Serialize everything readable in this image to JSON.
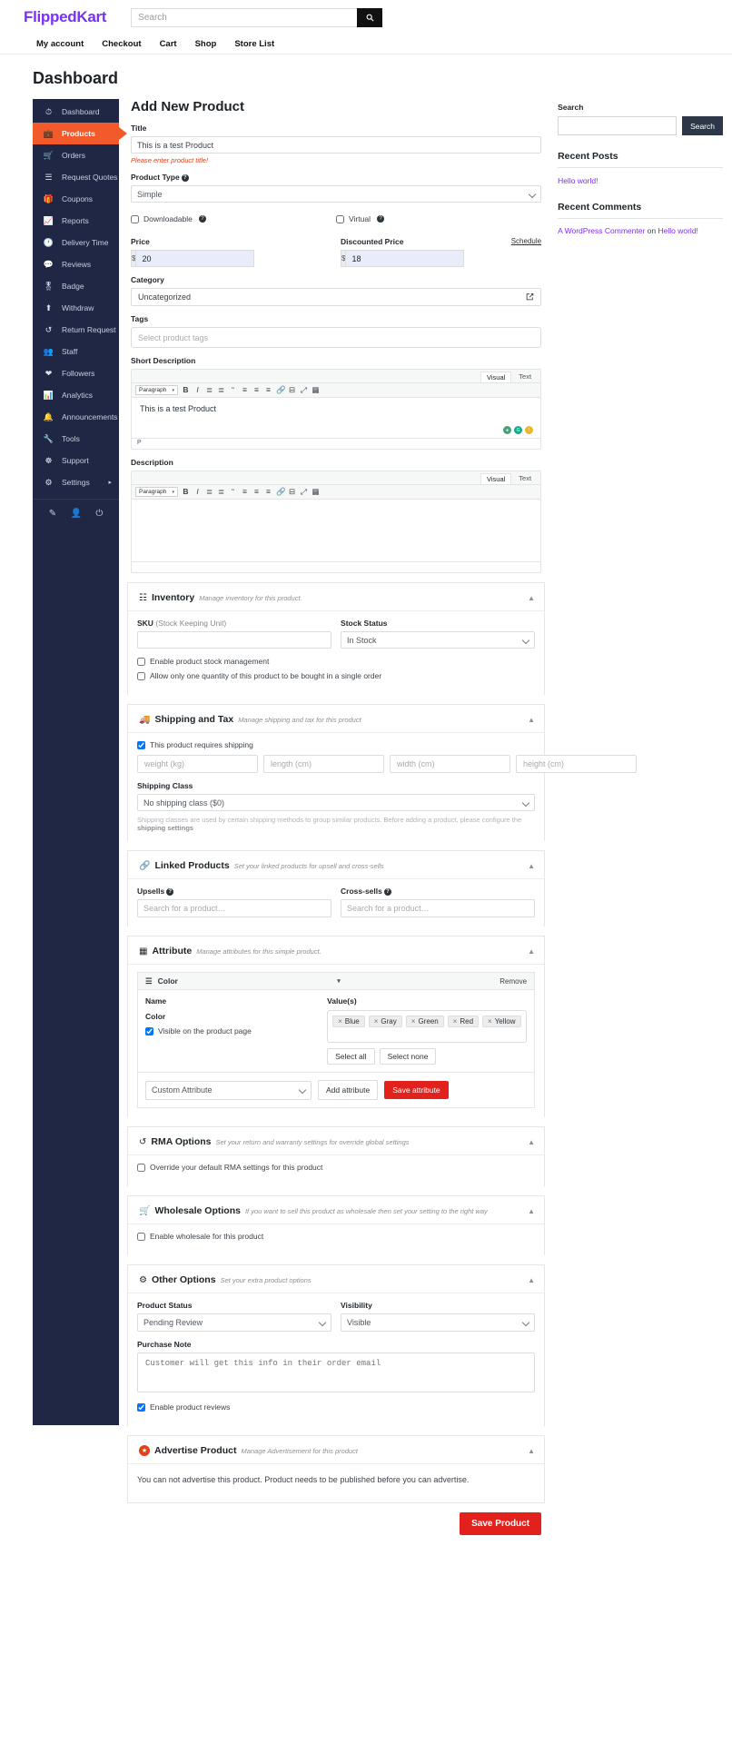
{
  "header": {
    "brand": "FlippedKart",
    "search_placeholder": "Search",
    "search_value": "",
    "search_icon": "search-icon",
    "nav": [
      "My account",
      "Checkout",
      "Cart",
      "Shop",
      "Store List"
    ]
  },
  "page": {
    "title": "Dashboard"
  },
  "sidebar": {
    "items": [
      {
        "label": "Dashboard",
        "icon": "speedometer-icon",
        "active": false
      },
      {
        "label": "Products",
        "icon": "briefcase-icon",
        "active": true
      },
      {
        "label": "Orders",
        "icon": "cart-icon",
        "active": false
      },
      {
        "label": "Request Quotes",
        "icon": "list-icon",
        "active": false
      },
      {
        "label": "Coupons",
        "icon": "gift-icon",
        "active": false
      },
      {
        "label": "Reports",
        "icon": "chart-icon",
        "active": false
      },
      {
        "label": "Delivery Time",
        "icon": "clock-icon",
        "active": false
      },
      {
        "label": "Reviews",
        "icon": "comment-icon",
        "active": false
      },
      {
        "label": "Badge",
        "icon": "medal-icon",
        "active": false
      },
      {
        "label": "Withdraw",
        "icon": "upload-icon",
        "active": false
      },
      {
        "label": "Return Request",
        "icon": "undo-icon",
        "active": false
      },
      {
        "label": "Staff",
        "icon": "users-icon",
        "active": false
      },
      {
        "label": "Followers",
        "icon": "heart-icon",
        "active": false
      },
      {
        "label": "Analytics",
        "icon": "bars-icon",
        "active": false
      },
      {
        "label": "Announcements",
        "icon": "bell-icon",
        "active": false
      },
      {
        "label": "Tools",
        "icon": "wrench-icon",
        "active": false
      },
      {
        "label": "Support",
        "icon": "lifering-icon",
        "active": false
      },
      {
        "label": "Settings",
        "icon": "gear-icon",
        "active": false,
        "caret": "▸"
      }
    ],
    "bottom_icons": [
      "edit-icon",
      "user-icon",
      "power-icon"
    ]
  },
  "main": {
    "title": "Add New Product",
    "title_label": "Title",
    "title_value": "This is a test Product",
    "title_error": "Please enter product title!",
    "product_type_label": "Product Type",
    "product_type_value": "Simple",
    "downloadable_label": "Downloadable",
    "virtual_label": "Virtual",
    "price_label": "Price",
    "price_currency": "$",
    "price_value": "20",
    "discounted_label": "Discounted Price",
    "discounted_currency": "$",
    "discounted_value": "18",
    "schedule_label": "Schedule",
    "category_label": "Category",
    "category_value": "Uncategorized",
    "category_edit_icon": "edit-square-icon",
    "tags_label": "Tags",
    "tags_placeholder": "Select product tags",
    "short_desc_label": "Short Description",
    "short_desc_body": "This is a test Product",
    "short_desc_status": "P",
    "desc_label": "Description",
    "desc_body": "",
    "editor_tabs": [
      "Visual",
      "Text"
    ],
    "editor_paragraph": "Paragraph",
    "editor_buttons": [
      "bold-icon",
      "italic-icon",
      "bulleted-list-icon",
      "numbered-list-icon",
      "blockquote-icon",
      "align-left-icon",
      "align-center-icon",
      "align-right-icon",
      "link-icon",
      "read-more-icon",
      "fullscreen-icon",
      "toolbar-toggle-icon"
    ]
  },
  "inventory": {
    "title": "Inventory",
    "subtitle": "Manage inventory for this product.",
    "icon": "boxes-icon",
    "sku_label_bold": "SKU",
    "sku_label_rest": " (Stock Keeping Unit)",
    "sku_value": "",
    "stock_status_label": "Stock Status",
    "stock_status_value": "In Stock",
    "check_stock_mgmt": "Enable product stock management",
    "check_single_qty": "Allow only one quantity of this product to be bought in a single order"
  },
  "shipping": {
    "title": "Shipping and Tax",
    "subtitle": "Manage shipping and tax for this product",
    "icon": "truck-icon",
    "requires_shipping": "This product requires shipping",
    "requires_shipping_checked": true,
    "fields": [
      "weight (kg)",
      "length (cm)",
      "width (cm)",
      "height (cm)"
    ],
    "class_label": "Shipping Class",
    "class_value": "No shipping class ($0)",
    "note_prefix": "Shipping classes are used by certain shipping methods to group similar products. Before adding a product, please configure the ",
    "note_link": "shipping settings"
  },
  "linked": {
    "title": "Linked Products",
    "subtitle": "Set your linked products for upsell and cross-sells",
    "icon": "link-icon",
    "upsells_label": "Upsells",
    "upsells_placeholder": "Search for a product…",
    "crosssells_label": "Cross-sells",
    "crosssells_placeholder": "Search for a product…"
  },
  "attribute": {
    "title": "Attribute",
    "subtitle": "Manage attributes for this simple product.",
    "icon": "table-icon",
    "row_name": "Color",
    "row_handle_icon": "drag-handle-icon",
    "remove_label": "Remove",
    "name_col": "Name",
    "values_col": "Value(s)",
    "attr_name": "Color",
    "visible_label": "Visible on the product page",
    "visible_checked": true,
    "chips": [
      "Blue",
      "Gray",
      "Green",
      "Red",
      "Yellow"
    ],
    "select_all": "Select all",
    "select_none": "Select none",
    "custom_attribute": "Custom Attribute",
    "add_attribute": "Add attribute",
    "save_attribute": "Save attribute"
  },
  "rma": {
    "title": "RMA Options",
    "subtitle": "Set your return and warranty settings for override global settings",
    "icon": "undo-icon",
    "override_label": "Override your default RMA settings for this product"
  },
  "wholesale": {
    "title": "Wholesale Options",
    "subtitle": "If you want to sell this product as wholesale then set your setting to the right way",
    "icon": "cart-plus-icon",
    "enable_label": "Enable wholesale for this product"
  },
  "other": {
    "title": "Other Options",
    "subtitle": "Set your extra product options",
    "icon": "gear-icon",
    "status_label": "Product Status",
    "status_value": "Pending Review",
    "visibility_label": "Visibility",
    "visibility_value": "Visible",
    "purchase_note_label": "Purchase Note",
    "purchase_note_placeholder": "Customer will get this info in their order email",
    "reviews_label": "Enable product reviews",
    "reviews_checked": true
  },
  "advertise": {
    "title": "Advertise Product",
    "subtitle": "Manage Advertisement for this product",
    "icon": "advertise-icon",
    "message": "You can not advertise this product. Product needs to be published before you can advertise."
  },
  "footer": {
    "save_label": "Save Product"
  },
  "widgets": {
    "search_title": "Search",
    "search_value": "",
    "search_button": "Search",
    "recent_posts_title": "Recent Posts",
    "recent_posts": [
      "Hello world!"
    ],
    "recent_comments_title": "Recent Comments",
    "comment_author": "A WordPress Commenter",
    "comment_on": "on",
    "comment_post": "Hello world!"
  },
  "colors": {
    "accent": "#f25a2b",
    "sidebar": "#1f2744",
    "danger": "#e2211c",
    "brand": "#7b2ff7"
  }
}
